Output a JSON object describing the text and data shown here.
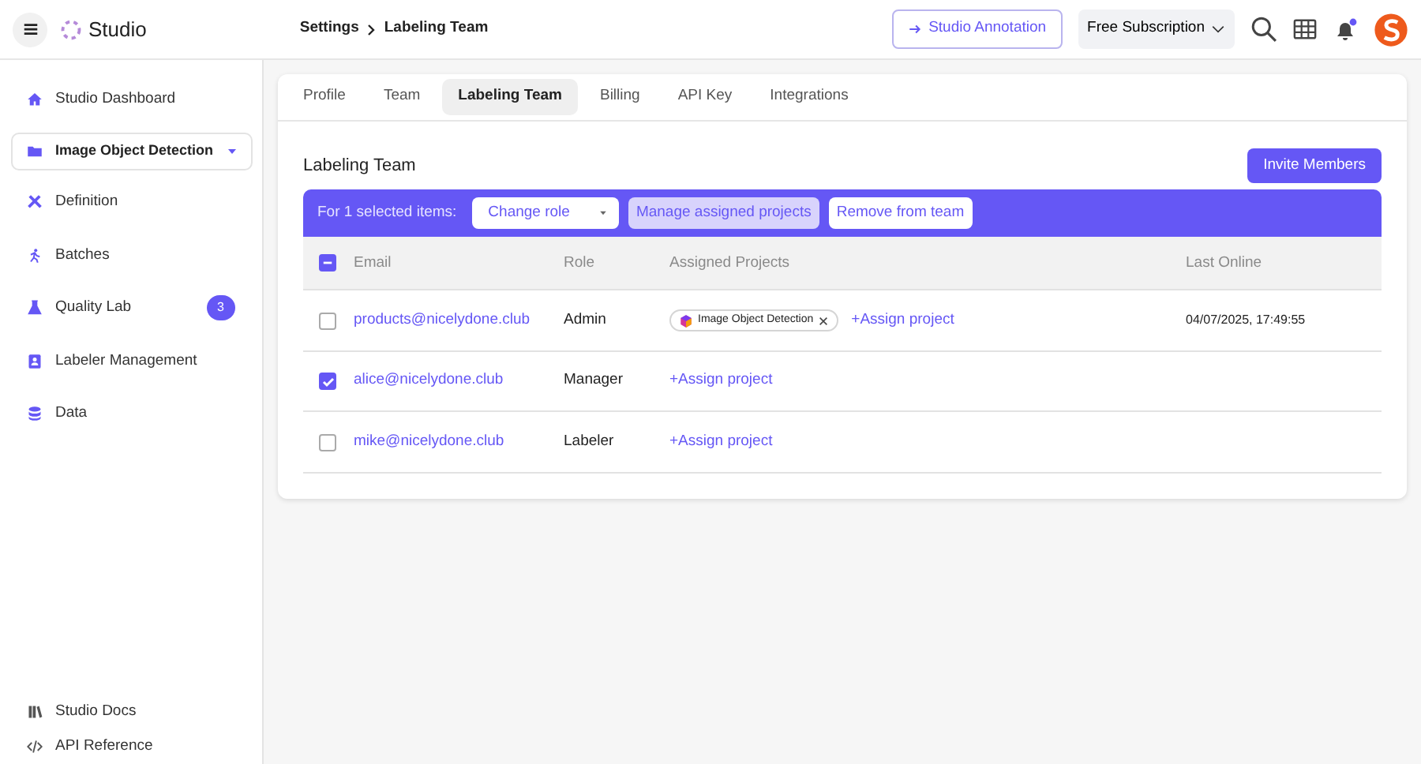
{
  "header": {
    "app_name": "Studio",
    "breadcrumb": [
      "Settings",
      "Labeling Team"
    ],
    "annotation_button": "Studio Annotation",
    "subscription": "Free Subscription",
    "notification_unread": true
  },
  "sidebar": {
    "items": [
      {
        "label": "Studio Dashboard",
        "kind": "link"
      },
      {
        "label": "Image Object Detection",
        "kind": "select"
      },
      {
        "label": "Definition",
        "kind": "link"
      },
      {
        "label": "Batches",
        "kind": "link"
      },
      {
        "label": "Quality Lab",
        "kind": "link",
        "badge": "3"
      },
      {
        "label": "Labeler Management",
        "kind": "link"
      },
      {
        "label": "Data",
        "kind": "link"
      }
    ],
    "footer_items": [
      "Studio Docs",
      "API Reference"
    ]
  },
  "tabs": [
    {
      "label": "Profile",
      "selected": false
    },
    {
      "label": "Team",
      "selected": false
    },
    {
      "label": "Labeling Team",
      "selected": true
    },
    {
      "label": "Billing",
      "selected": false
    },
    {
      "label": "API Key",
      "selected": false
    },
    {
      "label": "Integrations",
      "selected": false
    }
  ],
  "section_title": "Labeling Team",
  "invite_button": "Invite Members",
  "bulk_bar": {
    "label": "For 1 selected items:",
    "actions": [
      {
        "label": "Change role",
        "kind": "dropdown",
        "highlighted": false
      },
      {
        "label": "Manage assigned projects",
        "kind": "button",
        "highlighted": true
      },
      {
        "label": "Remove from team",
        "kind": "button",
        "highlighted": false
      }
    ]
  },
  "table": {
    "select_all_indeterminate": true,
    "columns": [
      "Email",
      "Role",
      "Assigned Projects",
      "Last Online"
    ],
    "rows": [
      {
        "email": "products@nicelydone.club",
        "role": "Admin",
        "projects": [
          "Image Object Detection"
        ],
        "assign_link": "+Assign project",
        "last_online": "04/07/2025, 17:49:55",
        "checked": false
      },
      {
        "email": "alice@nicelydone.club",
        "role": "Manager",
        "projects": [],
        "assign_link": "+Assign project",
        "last_online": "",
        "checked": true
      },
      {
        "email": "mike@nicelydone.club",
        "role": "Labeler",
        "projects": [],
        "assign_link": "+Assign project",
        "last_online": "",
        "checked": false
      }
    ]
  }
}
